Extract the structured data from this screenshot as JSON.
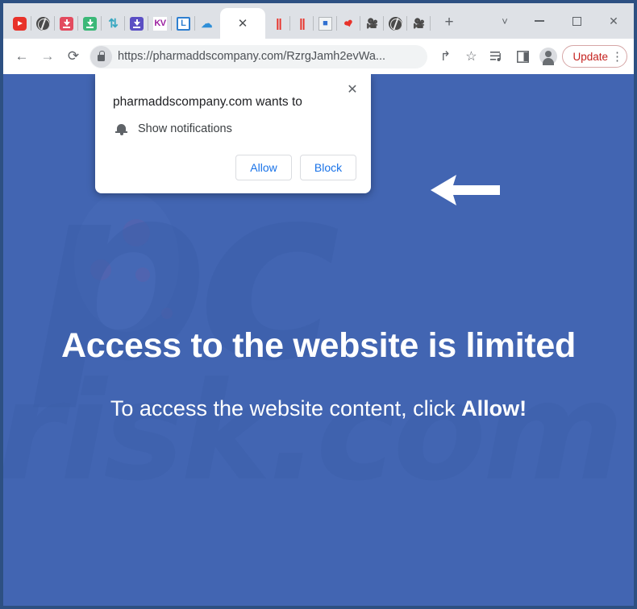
{
  "window": {
    "controls": {
      "tab_search": "tab-search-chevron",
      "minimize": "minimize",
      "maximize": "maximize",
      "close": "close"
    }
  },
  "tabstrip": {
    "pinned_tabs": [
      {
        "name": "youtube-favicon-tab",
        "icon": "youtube-icon"
      },
      {
        "name": "globe-favicon-tab",
        "icon": "globe-icon"
      },
      {
        "name": "red-download-favicon-tab",
        "icon": "download-red-icon"
      },
      {
        "name": "green-download-favicon-tab",
        "icon": "download-green-icon"
      },
      {
        "name": "swap-favicon-tab",
        "icon": "swap-arrows-icon"
      },
      {
        "name": "purple-download-favicon-tab",
        "icon": "download-purple-icon"
      },
      {
        "name": "kv-favicon-tab",
        "icon": "kv-icon",
        "label": "KV"
      },
      {
        "name": "l-favicon-tab",
        "icon": "letter-l-icon",
        "label": "L"
      },
      {
        "name": "cloud-download-favicon-tab",
        "icon": "cloud-download-icon"
      }
    ],
    "active_tab": {
      "name": "active-tab",
      "title": "",
      "close_glyph": "✕"
    },
    "trailing_tabs": [
      {
        "name": "pause-bars-favicon-tab",
        "icon": "red-bars-icon"
      },
      {
        "name": "pause-bars-2-favicon-tab",
        "icon": "red-bars-icon"
      },
      {
        "name": "puzzle-favicon-tab",
        "icon": "puzzle-piece-icon"
      },
      {
        "name": "heart-favicon-tab",
        "icon": "red-tag-icon"
      },
      {
        "name": "dvd-camera-favicon-tab",
        "icon": "dvd-camera-icon"
      },
      {
        "name": "globe-2-favicon-tab",
        "icon": "globe-icon"
      },
      {
        "name": "dvd-camera-2-favicon-tab",
        "icon": "dvd-camera-icon"
      }
    ],
    "new_tab_glyph": "+"
  },
  "toolbar": {
    "back_glyph": "←",
    "forward_glyph": "→",
    "reload_glyph": "⟳",
    "url": "https://pharmaddscompany.com/RzrgJamh2evWa...",
    "share_glyph": "↱",
    "bookmark_glyph": "☆",
    "reading_list_glyph": "≡",
    "side_panel_glyph": "▣",
    "update_label": "Update",
    "menu_glyph": "⋮"
  },
  "permission_dialog": {
    "title": "pharmaddscompany.com wants to",
    "close_glyph": "✕",
    "permission_label": "Show notifications",
    "permission_icon": "bell-icon",
    "allow_label": "Allow",
    "block_label": "Block"
  },
  "page": {
    "headline": "Access to the website is limited",
    "subline_prefix": "To access the website content, click ",
    "subline_emphasis": "Allow!",
    "watermark_primary": "pc",
    "watermark_secondary": "risk.com",
    "annotation_arrow": "left-arrow-annotation"
  },
  "colors": {
    "page_background": "#4265b2",
    "frame_border": "#2d5082",
    "tabstrip": "#dee1e6",
    "dialog_link": "#1a73e8",
    "update_accent": "#c5221f"
  }
}
